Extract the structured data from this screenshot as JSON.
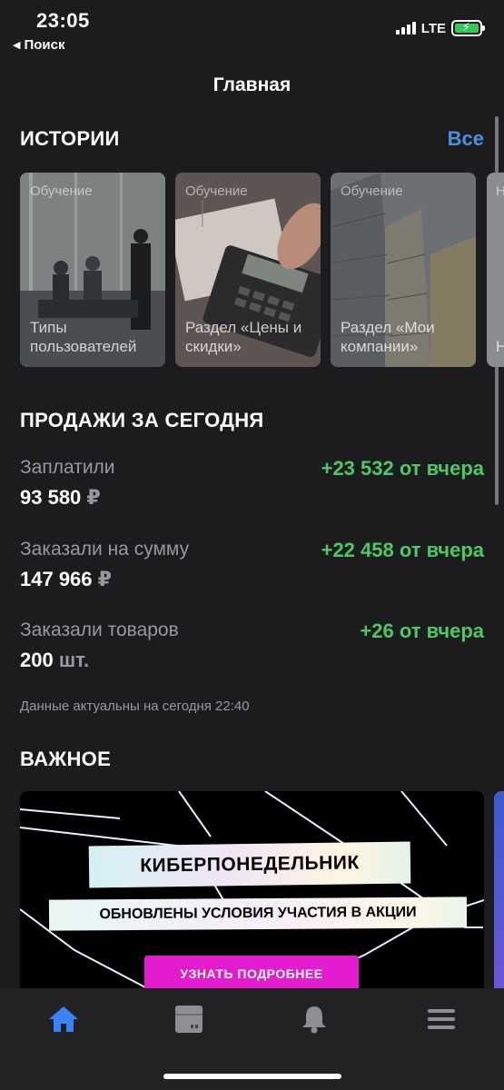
{
  "status_bar": {
    "time": "23:05",
    "back_label": "Поиск",
    "network": "LTE",
    "battery_color": "#34c759"
  },
  "nav": {
    "title": "Главная"
  },
  "stories": {
    "title": "ИСТОРИИ",
    "all_label": "Все",
    "items": [
      {
        "tag": "Обучение",
        "caption": "Типы пользователей"
      },
      {
        "tag": "Обучение",
        "caption": "Раздел «Цены и скидки»"
      },
      {
        "tag": "Обучение",
        "caption": "Раздел «Мои компании»"
      },
      {
        "tag": "Н",
        "caption": "Н п"
      }
    ]
  },
  "sales": {
    "title": "ПРОДАЖИ ЗА СЕГОДНЯ",
    "metrics": [
      {
        "label": "Заплатили",
        "value": "93 580",
        "unit": "₽",
        "delta": "+23 532 от вчера"
      },
      {
        "label": "Заказали на сумму",
        "value": "147 966",
        "unit": "₽",
        "delta": "+22 458 от вчера"
      },
      {
        "label": "Заказали товаров",
        "value": "200",
        "unit": "шт.",
        "delta": "+26 от вчера"
      }
    ],
    "updated": "Данные актуальны на сегодня 22:40",
    "delta_color": "#4cc864"
  },
  "important": {
    "title": "ВАЖНОЕ",
    "banner": {
      "title": "КИБЕРПОНЕДЕЛЬНИК",
      "subtitle": "ОБНОВЛЕНЫ УСЛОВИЯ УЧАСТИЯ В АКЦИИ",
      "button": "УЗНАТЬ ПОДРОБНЕЕ",
      "button_color": "#e31ccf"
    }
  },
  "tab_bar": {
    "active_color": "#3b82f6",
    "items": [
      {
        "icon": "home-icon",
        "active": true
      },
      {
        "icon": "box-icon",
        "active": false
      },
      {
        "icon": "bell-icon",
        "active": false
      },
      {
        "icon": "menu-icon",
        "active": false
      }
    ]
  }
}
